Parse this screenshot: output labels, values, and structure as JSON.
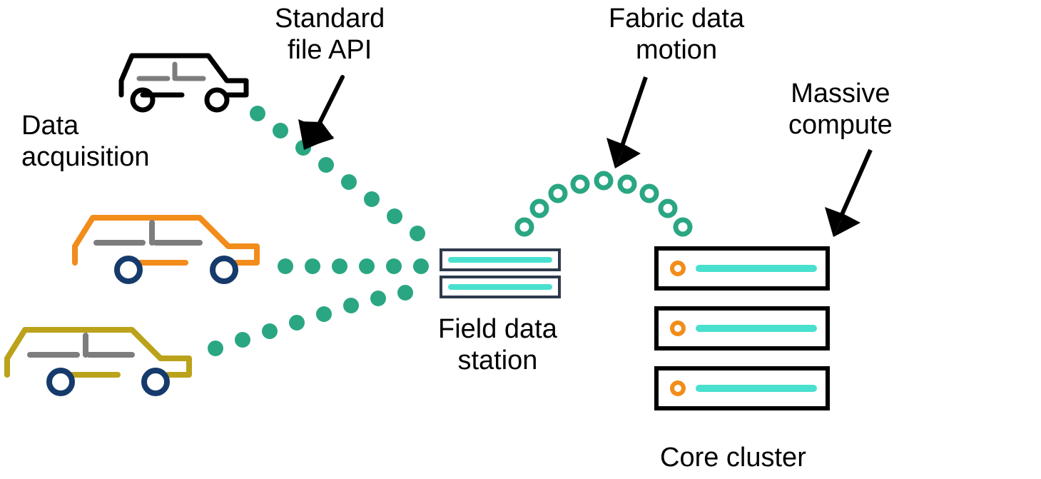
{
  "labels": {
    "data_acquisition": "Data\nacquisition",
    "standard_file_api": "Standard\nfile API",
    "fabric_data_motion": "Fabric data\nmotion",
    "massive_compute": "Massive\ncompute",
    "field_data_station": "Field data\nstation",
    "core_cluster": "Core cluster"
  },
  "colors": {
    "green": "#2aa683",
    "teal": "#49e0cf",
    "orange": "#f28c1b",
    "gold": "#bba21b",
    "navy": "#163a6b",
    "darkgray": "#7d7d7d",
    "black": "#000000",
    "stationStroke": "#2e3a4c"
  }
}
